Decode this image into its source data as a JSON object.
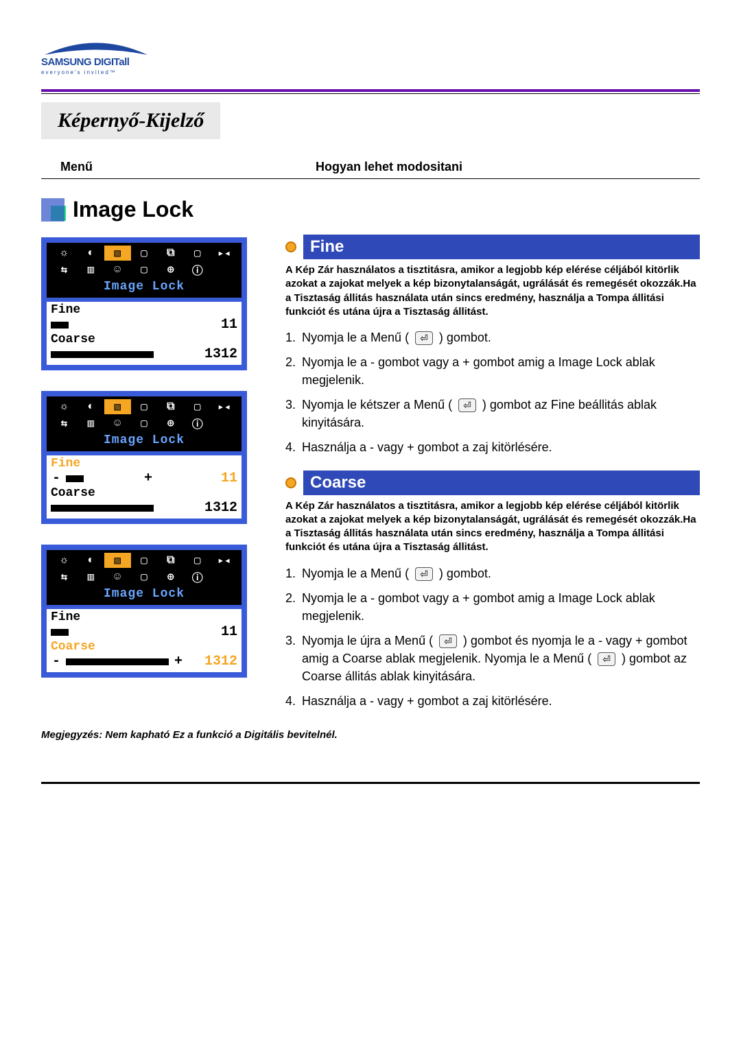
{
  "logo": {
    "brand": "SAMSUNG DIGITall",
    "tag": "everyone's invited™"
  },
  "title": "Képernyő-Kijelző",
  "columns": {
    "left": "Menű",
    "right": "Hogyan lehet modositani"
  },
  "section_heading": "Image Lock",
  "osd_common": {
    "title": "Image Lock",
    "fine_label": "Fine",
    "coarse_label": "Coarse",
    "fine_value": "11",
    "coarse_value": "1312",
    "minus": "-",
    "plus": "+"
  },
  "icons": {
    "r0": [
      "☼",
      "◐",
      "▧",
      "▢",
      "⧉",
      "▢",
      "▸◂"
    ],
    "r1": [
      "⇆",
      "▥",
      "☺",
      "▢",
      "⊕",
      "ⓘ",
      ""
    ]
  },
  "fine": {
    "title": "Fine",
    "desc": "A Kép Zár használatos a tisztitásra, amikor a legjobb kép elérése céljából kitörlik azokat a zajokat melyek a kép bizonytalanságát, ugrálását és remegését okozzák.Ha a Tisztaság állitás használata után sincs eredmény, használja a Tompa állitási funkciót és utána újra a Tisztaság állitást.",
    "steps": [
      {
        "n": "1.",
        "pre": "Nyomja le a Menű (",
        "post": ") gombot."
      },
      {
        "n": "2.",
        "pre": "Nyomja le a - gombot vagy a + gombot amig a Image Lock ablak megjelenik.",
        "post": ""
      },
      {
        "n": "3.",
        "pre": "Nyomja le kétszer a Menű (",
        "post": ") gombot az Fine beállitás ablak kinyitására."
      },
      {
        "n": "4.",
        "pre": "Használja a - vagy + gombot a zaj kitörlésére.",
        "post": ""
      }
    ]
  },
  "coarse": {
    "title": "Coarse",
    "desc": "A Kép Zár használatos a tisztitásra, amikor a legjobb kép elérése céljából kitörlik azokat a zajokat melyek a kép bizonytalanságát, ugrálását és remegését okozzák.Ha a Tisztaság állitás használata után sincs eredmény, használja a Tompa állitási funkciót és utána újra a Tisztaság állitást.",
    "steps": [
      {
        "n": "1.",
        "pre": "Nyomja le a Menű (",
        "post": ") gombot."
      },
      {
        "n": "2.",
        "pre": "Nyomja le a - gombot vagy a + gombot amig a Image Lock ablak megjelenik.",
        "post": ""
      },
      {
        "n": "3.",
        "pre": "Nyomja le újra a Menű (",
        "mid1": ") gombot és nyomja le a - vagy + gombot amig a Coarse ablak megjelenik. Nyomja le a Menű (",
        "post": ")  gombot az Coarse állitás ablak kinyitására."
      },
      {
        "n": "4.",
        "pre": "Használja a - vagy + gombot a zaj kitörlésére.",
        "post": ""
      }
    ]
  },
  "note": "Megjegyzés: Nem kapható Ez a funkció a Digitális bevitelnél.",
  "enter_glyph": "⏎"
}
